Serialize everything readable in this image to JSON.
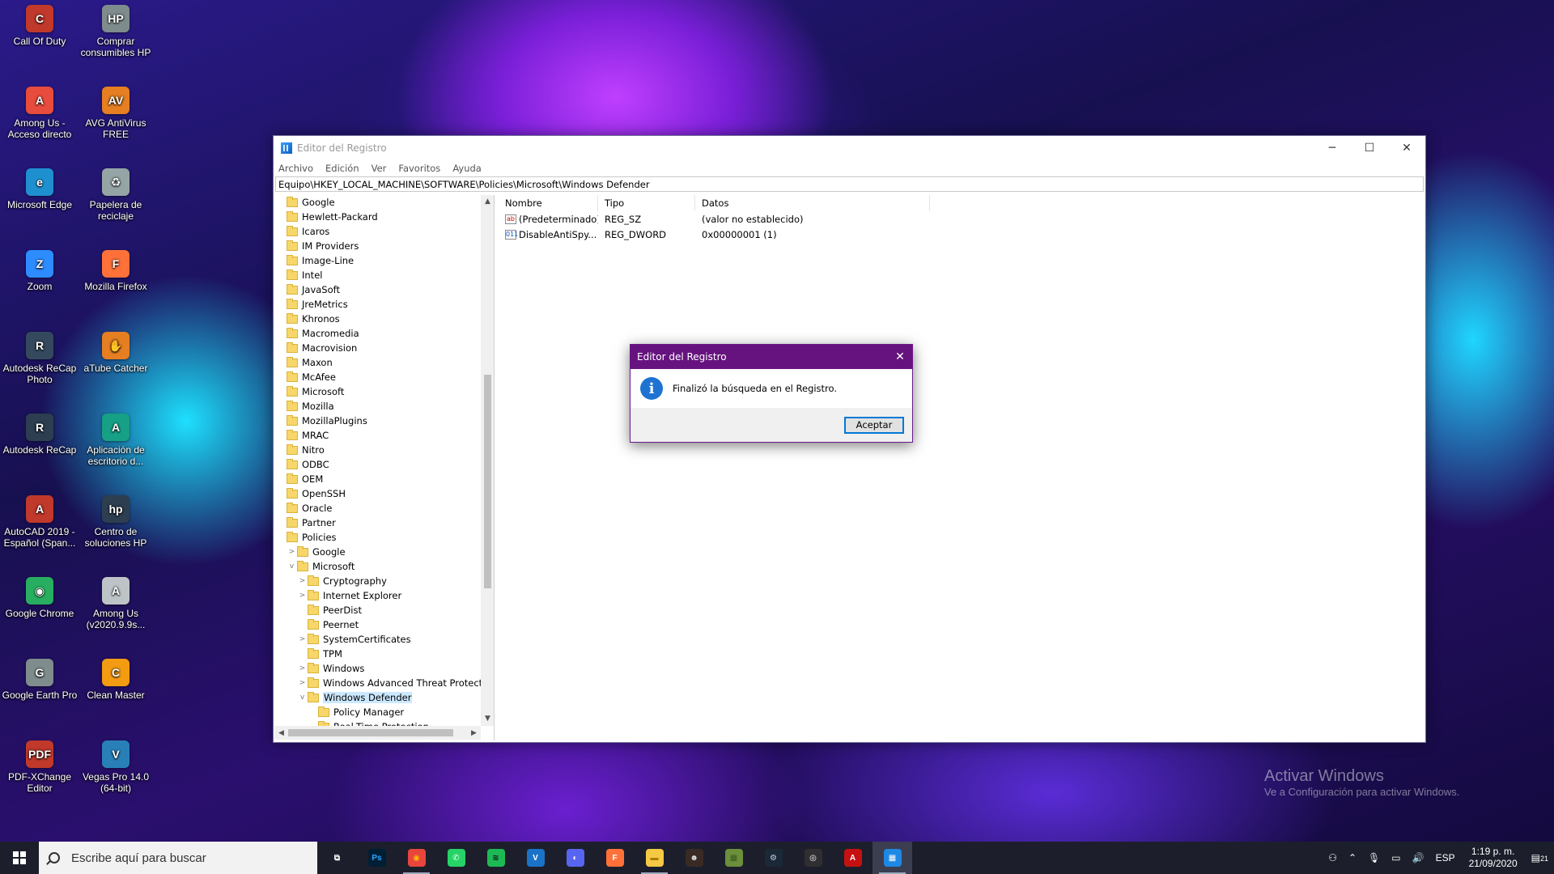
{
  "desktop": {
    "icons": [
      {
        "label": "Call Of Duty",
        "color": "#c0392b",
        "glyph": "C"
      },
      {
        "label": "Comprar consumibles HP",
        "color": "#7f8c8d",
        "glyph": "HP"
      },
      {
        "label": "Among Us - Acceso directo",
        "color": "#e74c3c",
        "glyph": "A"
      },
      {
        "label": "AVG AntiVirus FREE",
        "color": "#e67e22",
        "glyph": "AV"
      },
      {
        "label": "Microsoft Edge",
        "color": "#1e90d0",
        "glyph": "e"
      },
      {
        "label": "Papelera de reciclaje",
        "color": "#95a5a6",
        "glyph": "♻"
      },
      {
        "label": "Zoom",
        "color": "#2d8cff",
        "glyph": "Z"
      },
      {
        "label": "Mozilla Firefox",
        "color": "#ff7139",
        "glyph": "F"
      },
      {
        "label": "Autodesk ReCap Photo",
        "color": "#34495e",
        "glyph": "R"
      },
      {
        "label": "aTube Catcher",
        "color": "#e67e22",
        "glyph": "✋"
      },
      {
        "label": "Autodesk ReCap",
        "color": "#2c3e50",
        "glyph": "R"
      },
      {
        "label": "Aplicación de escritorio d...",
        "color": "#16a085",
        "glyph": "A"
      },
      {
        "label": "AutoCAD 2019 - Español (Span...",
        "color": "#c0392b",
        "glyph": "A"
      },
      {
        "label": "Centro de soluciones HP",
        "color": "#2c3e50",
        "glyph": "hp"
      },
      {
        "label": "Google Chrome",
        "color": "#27ae60",
        "glyph": "◉"
      },
      {
        "label": "Among Us (v2020.9.9s...",
        "color": "#bdc3c7",
        "glyph": "A"
      },
      {
        "label": "Google Earth Pro",
        "color": "#7f8c8d",
        "glyph": "G"
      },
      {
        "label": "Clean Master",
        "color": "#f39c12",
        "glyph": "C"
      },
      {
        "label": "PDF-XChange Editor",
        "color": "#c0392b",
        "glyph": "PDF"
      },
      {
        "label": "Vegas Pro 14.0 (64-bit)",
        "color": "#2980b9",
        "glyph": "V"
      }
    ]
  },
  "regedit": {
    "title": "Editor del Registro",
    "controls": {
      "minimize": "─",
      "maximize": "☐",
      "close": "✕"
    },
    "menu": [
      "Archivo",
      "Edición",
      "Ver",
      "Favoritos",
      "Ayuda"
    ],
    "address": "Equipo\\HKEY_LOCAL_MACHINE\\SOFTWARE\\Policies\\Microsoft\\Windows Defender",
    "tree": [
      {
        "label": "Google",
        "indent": 0,
        "exp": ""
      },
      {
        "label": "Hewlett-Packard",
        "indent": 0,
        "exp": ""
      },
      {
        "label": "Icaros",
        "indent": 0,
        "exp": ""
      },
      {
        "label": "IM Providers",
        "indent": 0,
        "exp": ""
      },
      {
        "label": "Image-Line",
        "indent": 0,
        "exp": ""
      },
      {
        "label": "Intel",
        "indent": 0,
        "exp": ""
      },
      {
        "label": "JavaSoft",
        "indent": 0,
        "exp": ""
      },
      {
        "label": "JreMetrics",
        "indent": 0,
        "exp": ""
      },
      {
        "label": "Khronos",
        "indent": 0,
        "exp": ""
      },
      {
        "label": "Macromedia",
        "indent": 0,
        "exp": ""
      },
      {
        "label": "Macrovision",
        "indent": 0,
        "exp": ""
      },
      {
        "label": "Maxon",
        "indent": 0,
        "exp": ""
      },
      {
        "label": "McAfee",
        "indent": 0,
        "exp": ""
      },
      {
        "label": "Microsoft",
        "indent": 0,
        "exp": ""
      },
      {
        "label": "Mozilla",
        "indent": 0,
        "exp": ""
      },
      {
        "label": "MozillaPlugins",
        "indent": 0,
        "exp": ""
      },
      {
        "label": "MRAC",
        "indent": 0,
        "exp": ""
      },
      {
        "label": "Nitro",
        "indent": 0,
        "exp": ""
      },
      {
        "label": "ODBC",
        "indent": 0,
        "exp": ""
      },
      {
        "label": "OEM",
        "indent": 0,
        "exp": ""
      },
      {
        "label": "OpenSSH",
        "indent": 0,
        "exp": ""
      },
      {
        "label": "Oracle",
        "indent": 0,
        "exp": ""
      },
      {
        "label": "Partner",
        "indent": 0,
        "exp": ""
      },
      {
        "label": "Policies",
        "indent": 0,
        "exp": ""
      },
      {
        "label": "Google",
        "indent": 1,
        "exp": ">"
      },
      {
        "label": "Microsoft",
        "indent": 1,
        "exp": "v"
      },
      {
        "label": "Cryptography",
        "indent": 2,
        "exp": ">"
      },
      {
        "label": "Internet Explorer",
        "indent": 2,
        "exp": ">"
      },
      {
        "label": "PeerDist",
        "indent": 2,
        "exp": ""
      },
      {
        "label": "Peernet",
        "indent": 2,
        "exp": ""
      },
      {
        "label": "SystemCertificates",
        "indent": 2,
        "exp": ">"
      },
      {
        "label": "TPM",
        "indent": 2,
        "exp": ""
      },
      {
        "label": "Windows",
        "indent": 2,
        "exp": ">"
      },
      {
        "label": "Windows Advanced Threat Protection",
        "indent": 2,
        "exp": ">"
      },
      {
        "label": "Windows Defender",
        "indent": 2,
        "exp": "v",
        "selected": true
      },
      {
        "label": "Policy Manager",
        "indent": 3,
        "exp": ""
      },
      {
        "label": "Real-Time Protection",
        "indent": 3,
        "exp": ""
      }
    ],
    "columns": [
      "Nombre",
      "Tipo",
      "Datos"
    ],
    "values": [
      {
        "icon": "ab",
        "name": "(Predeterminado)",
        "type": "REG_SZ",
        "data": "(valor no establecido)"
      },
      {
        "icon": "011",
        "name": "DisableAntiSpy...",
        "type": "REG_DWORD",
        "data": "0x00000001 (1)"
      }
    ]
  },
  "dialog": {
    "title": "Editor del Registro",
    "message": "Finalizó la búsqueda en el Registro.",
    "button": "Aceptar",
    "close": "✕",
    "info_glyph": "i"
  },
  "watermark": {
    "line1": "Activar Windows",
    "line2": "Ve a Configuración para activar Windows."
  },
  "taskbar": {
    "search_placeholder": "Escribe aquí para buscar",
    "apps": [
      {
        "name": "task-view",
        "glyph": "⧉",
        "bg": "transparent",
        "fg": "#fff"
      },
      {
        "name": "photoshop",
        "glyph": "Ps",
        "bg": "#001e36",
        "fg": "#31a8ff"
      },
      {
        "name": "chrome",
        "glyph": "◉",
        "bg": "#e8453c",
        "fg": "#fbbc05",
        "running": true
      },
      {
        "name": "whatsapp",
        "glyph": "✆",
        "bg": "#25d366",
        "fg": "#fff"
      },
      {
        "name": "spotify",
        "glyph": "≋",
        "bg": "#1db954",
        "fg": "#111"
      },
      {
        "name": "vegas",
        "glyph": "V",
        "bg": "#1a73c9",
        "fg": "#fff"
      },
      {
        "name": "discord",
        "glyph": "◐",
        "bg": "#5865f2",
        "fg": "#fff"
      },
      {
        "name": "firefox",
        "glyph": "F",
        "bg": "#ff7139",
        "fg": "#fff"
      },
      {
        "name": "file-explorer",
        "glyph": "▬",
        "bg": "#f6c944",
        "fg": "#a87b00",
        "running": true
      },
      {
        "name": "game-app",
        "glyph": "☻",
        "bg": "#3a2a25",
        "fg": "#ddd"
      },
      {
        "name": "minecraft",
        "glyph": "▦",
        "bg": "#6b8f3a",
        "fg": "#3b5a1e"
      },
      {
        "name": "steam",
        "glyph": "⚙",
        "bg": "#1b2838",
        "fg": "#c7d5e0"
      },
      {
        "name": "obs",
        "glyph": "◎",
        "bg": "#302e31",
        "fg": "#fff"
      },
      {
        "name": "among-us",
        "glyph": "A",
        "bg": "#c51111",
        "fg": "#fff"
      },
      {
        "name": "regedit",
        "glyph": "▦",
        "bg": "#1e88e5",
        "fg": "#fff",
        "active": true,
        "running": true
      }
    ],
    "tray": {
      "language": "ESP",
      "time": "1:19 p. m.",
      "date": "21/09/2020",
      "notifications": "21"
    }
  }
}
